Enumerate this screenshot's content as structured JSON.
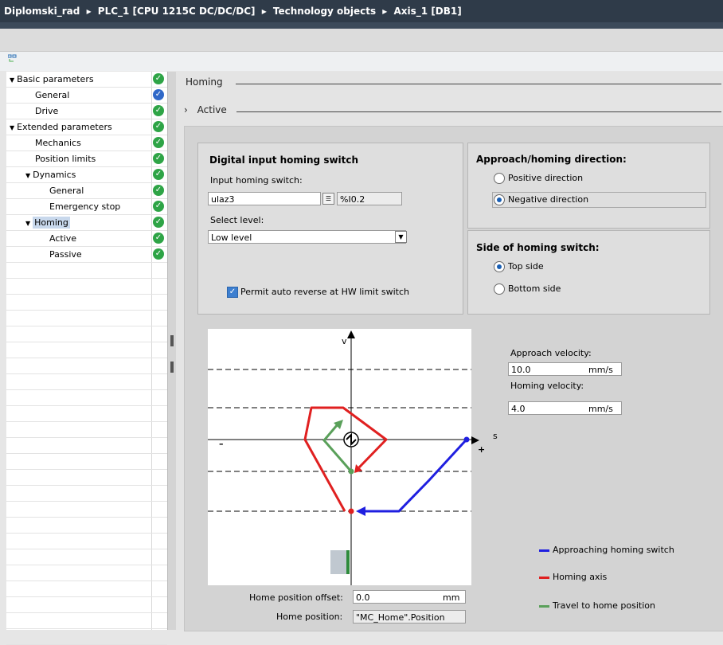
{
  "breadcrumb": [
    "Diplomski_rad",
    "PLC_1 [CPU 1215C DC/DC/DC]",
    "Technology objects",
    "Axis_1 [DB1]"
  ],
  "breadcrumb_sep": "▸",
  "tree": {
    "items": [
      {
        "label": "Basic parameters",
        "level": 0,
        "expander": "▼",
        "status": "green"
      },
      {
        "label": "General",
        "level": 1,
        "status": "blue"
      },
      {
        "label": "Drive",
        "level": 1,
        "status": "green"
      },
      {
        "label": "Extended parameters",
        "level": 0,
        "expander": "▼",
        "status": "green"
      },
      {
        "label": "Mechanics",
        "level": 1,
        "status": "green"
      },
      {
        "label": "Position limits",
        "level": 1,
        "status": "green"
      },
      {
        "label": "Dynamics",
        "level": 1,
        "expander": "▼",
        "status": "green"
      },
      {
        "label": "General",
        "level": 2,
        "status": "green"
      },
      {
        "label": "Emergency stop",
        "level": 2,
        "status": "green"
      },
      {
        "label": "Homing",
        "level": 1,
        "expander": "▼",
        "status": "green",
        "selected": true
      },
      {
        "label": "Active",
        "level": 2,
        "status": "green"
      },
      {
        "label": "Passive",
        "level": 2,
        "status": "green"
      }
    ],
    "empty_rows": 24
  },
  "section": {
    "title": "Homing"
  },
  "subsection": {
    "expander": "›",
    "title": "Active"
  },
  "digital_input": {
    "title": "Digital input homing switch",
    "input_label": "Input homing switch:",
    "input_value": "ulaz3",
    "address": "%I0.2",
    "level_label": "Select level:",
    "level_value": "Low level",
    "auto_reverse_label": "Permit auto reverse at HW limit switch",
    "auto_reverse_checked": true
  },
  "direction": {
    "title": "Approach/homing direction:",
    "options": [
      "Positive direction",
      "Negative direction"
    ],
    "selected": "Negative direction"
  },
  "side": {
    "title": "Side of homing switch:",
    "options": [
      "Top side",
      "Bottom side"
    ],
    "selected": "Top side"
  },
  "diagram": {
    "axis_v": "v",
    "axis_s": "s",
    "minus": "–",
    "plus": "+"
  },
  "velocities": {
    "approach_label": "Approach velocity:",
    "approach_value": "10.0",
    "approach_unit": "mm/s",
    "homing_label": "Homing velocity:",
    "homing_value": "4.0",
    "homing_unit": "mm/s"
  },
  "legend": [
    {
      "label": "Approaching homing switch",
      "color": "#1f1fe0"
    },
    {
      "label": "Homing axis",
      "color": "#e02020"
    },
    {
      "label": "Travel to home position",
      "color": "#5aa05a"
    }
  ],
  "home_offset": {
    "label": "Home position offset:",
    "value": "0.0",
    "unit": "mm"
  },
  "home_position": {
    "label": "Home position:",
    "value": "\"MC_Home\".Position"
  }
}
